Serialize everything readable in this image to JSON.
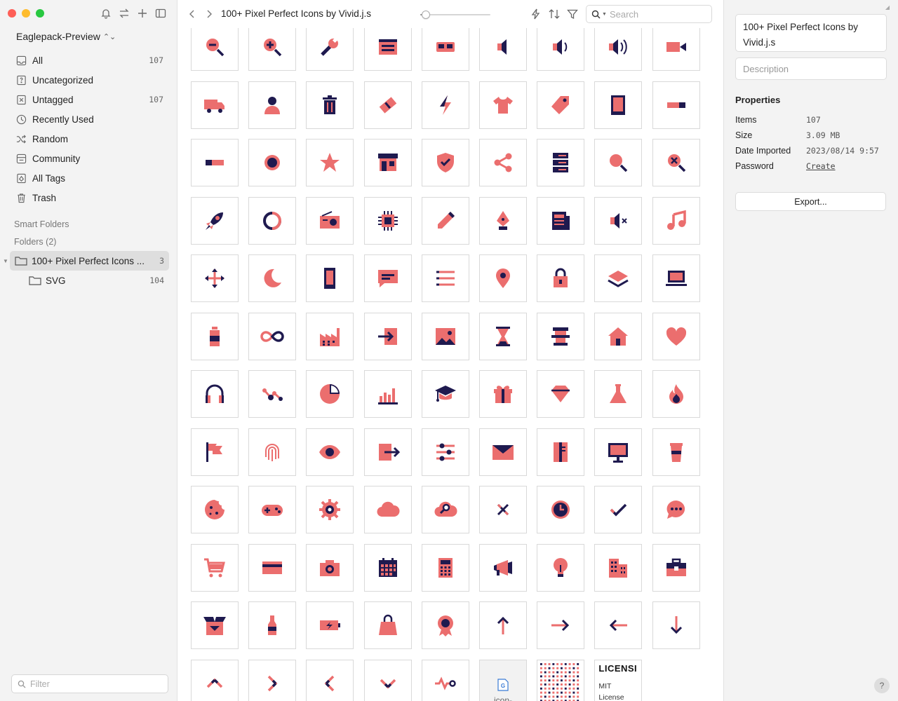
{
  "sidebar": {
    "library_name": "Eaglepack-Preview",
    "library_toggle": "⌃⌄",
    "nav": [
      {
        "label": "All",
        "count": "107",
        "icon": "inbox-icon"
      },
      {
        "label": "Uncategorized",
        "count": "",
        "icon": "question-folder-icon"
      },
      {
        "label": "Untagged",
        "count": "107",
        "icon": "untagged-icon"
      },
      {
        "label": "Recently Used",
        "count": "",
        "icon": "clock-icon"
      },
      {
        "label": "Random",
        "count": "",
        "icon": "shuffle-icon"
      },
      {
        "label": "Community",
        "count": "",
        "icon": "community-icon"
      },
      {
        "label": "All Tags",
        "count": "",
        "icon": "tag-icon"
      },
      {
        "label": "Trash",
        "count": "",
        "icon": "trash-icon"
      }
    ],
    "smart_folders_label": "Smart Folders",
    "folders_label": "Folders (2)",
    "folders": [
      {
        "label": "100+ Pixel Perfect Icons ...",
        "count": "3",
        "selected": true
      },
      {
        "label": "SVG",
        "count": "104",
        "selected": false
      }
    ],
    "filter_placeholder": "Filter"
  },
  "toolbar": {
    "title": "100+ Pixel Perfect Icons by Vivid.j.s",
    "zoom_level": 0.08,
    "search_placeholder": "Search"
  },
  "grid": {
    "icon_colors": {
      "coral": "#EB6E6E",
      "navy": "#1F1A4F"
    },
    "rows": [
      [
        "zoom-out-icon",
        "zoom-in-icon",
        "wrench-icon",
        "browser-window-icon",
        "vr-headset-icon",
        "speaker-low-icon",
        "speaker-medium-icon",
        "speaker-high-icon",
        "video-camera-icon"
      ],
      [
        "delivery-truck-icon",
        "user-icon",
        "trash-can-icon",
        "ticket-icon",
        "lightning-icon",
        "t-shirt-icon",
        "price-tag-icon",
        "tablet-icon",
        "toggle-switch-icon"
      ],
      [
        "toggle-off-icon",
        "sun-icon",
        "star-icon",
        "storefront-icon",
        "shield-check-icon",
        "share-icon",
        "server-icon",
        "search-icon",
        "search-close-icon"
      ],
      [
        "rocket-icon",
        "refresh-icon",
        "radio-icon",
        "cpu-chip-icon",
        "pencil-icon",
        "pen-nib-icon",
        "newspaper-icon",
        "mute-icon",
        "music-note-icon"
      ],
      [
        "move-arrows-icon",
        "moon-icon",
        "smartphone-icon",
        "chat-bubble-icon",
        "list-icon",
        "map-pin-icon",
        "padlock-icon",
        "layers-icon",
        "laptop-icon"
      ],
      [
        "bottle-icon",
        "infinity-icon",
        "factory-icon",
        "login-arrow-icon",
        "image-icon",
        "hourglass-icon",
        "temple-icon",
        "house-icon",
        "heart-icon"
      ],
      [
        "headphones-icon",
        "graph-nodes-icon",
        "pie-chart-icon",
        "bar-chart-icon",
        "graduation-cap-icon",
        "gift-icon",
        "diamond-icon",
        "flask-icon",
        "fire-icon"
      ],
      [
        "flag-icon",
        "fingerprint-icon",
        "eye-icon",
        "exit-arrow-icon",
        "sliders-icon",
        "envelope-icon",
        "document-icon",
        "monitor-icon",
        "coffee-cup-icon"
      ],
      [
        "cookie-icon",
        "gamepad-icon",
        "gear-icon",
        "cloud-icon",
        "cloud-search-icon",
        "close-x-icon",
        "clock-icon",
        "checkmark-icon",
        "chat-dots-icon"
      ],
      [
        "shopping-cart-icon",
        "credit-card-icon",
        "camera-icon",
        "calendar-icon",
        "calculator-icon",
        "megaphone-icon",
        "light-bulb-icon",
        "buildings-icon",
        "briefcase-icon"
      ],
      [
        "open-box-icon",
        "wine-bottle-icon",
        "battery-charging-icon",
        "shopping-bag-icon",
        "award-badge-icon",
        "arrow-up-icon",
        "arrow-right-icon",
        "arrow-left-icon",
        "arrow-down-icon"
      ],
      [
        "chevron-up-icon",
        "chevron-right-icon",
        "chevron-left-icon",
        "chevron-down-icon",
        "activity-pulse-icon"
      ]
    ],
    "special_tiles": {
      "file_tile_name": "icon-",
      "license_title": "LICENSI",
      "license_line1": "MIT",
      "license_line2": "License"
    }
  },
  "panel": {
    "name": "100+ Pixel Perfect Icons by Vivid.j.s",
    "description_placeholder": "Description",
    "properties_title": "Properties",
    "properties": [
      {
        "key": "Items",
        "value": "107"
      },
      {
        "key": "Size",
        "value": "3.09 MB"
      },
      {
        "key": "Date Imported",
        "value": "2023/08/14 9:57"
      },
      {
        "key": "Password",
        "value": "Create"
      }
    ],
    "export_label": "Export...",
    "help_label": "?"
  }
}
